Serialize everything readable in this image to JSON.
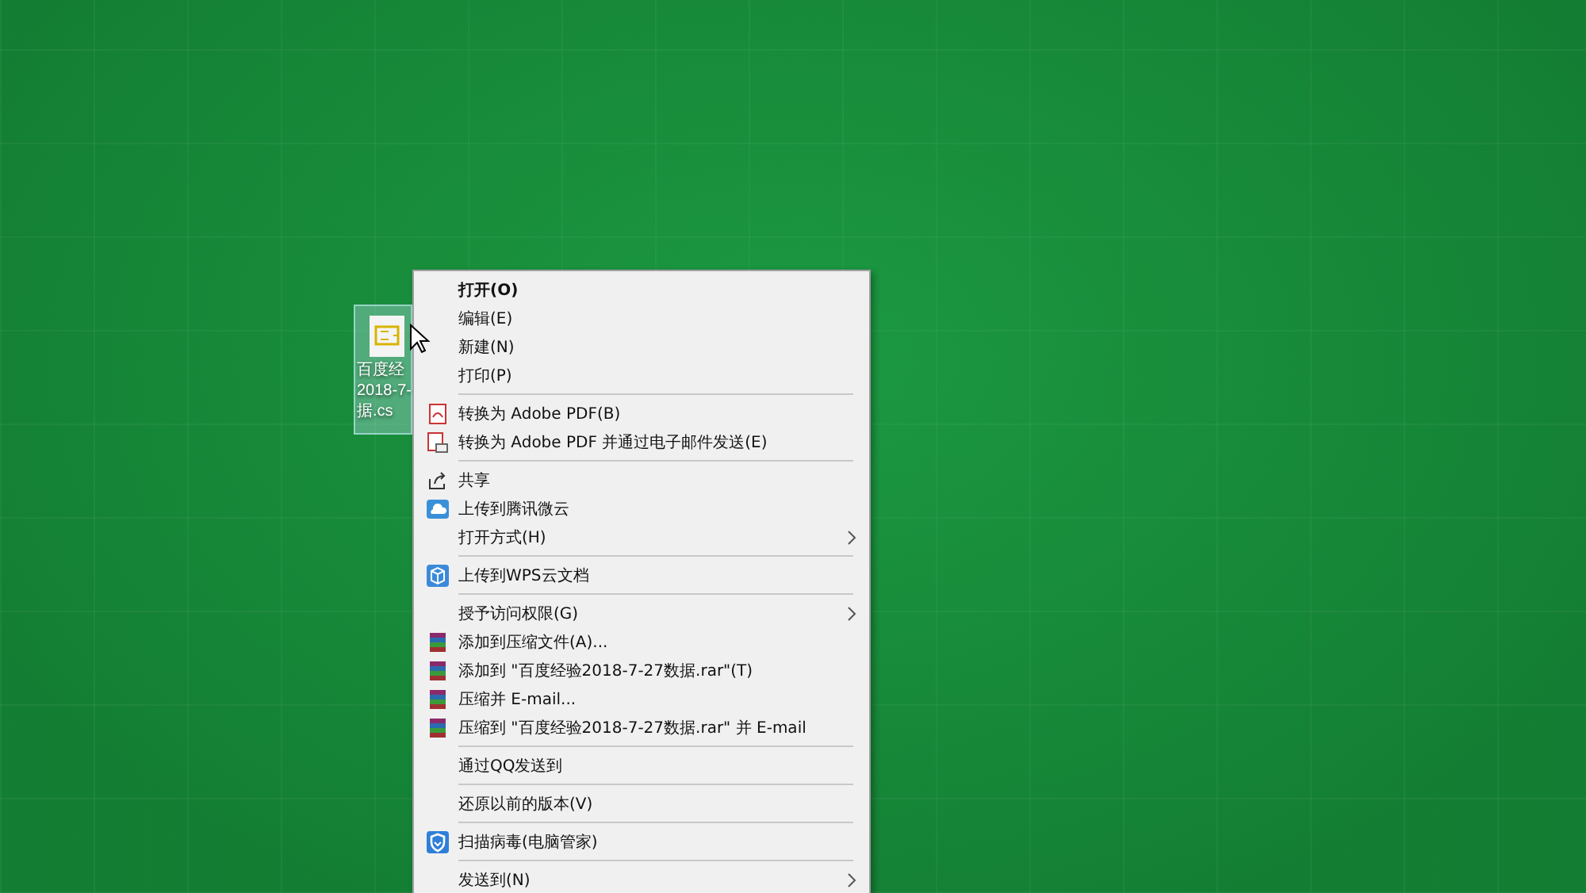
{
  "desktop_icon": {
    "label_lines": [
      "百度经",
      "2018-7-",
      "据.cs"
    ],
    "selected": true
  },
  "context_menu": {
    "sections": [
      {
        "items": [
          {
            "label": "打开(O)",
            "kind": "plain",
            "default": true,
            "submenu": false
          },
          {
            "label": "编辑(E)",
            "kind": "plain",
            "default": false,
            "submenu": false
          },
          {
            "label": "新建(N)",
            "kind": "plain",
            "default": false,
            "submenu": false
          },
          {
            "label": "打印(P)",
            "kind": "plain",
            "default": false,
            "submenu": false
          }
        ]
      },
      {
        "items": [
          {
            "label": "转换为 Adobe PDF(B)",
            "kind": "pdf",
            "default": false,
            "submenu": false
          },
          {
            "label": "转换为 Adobe PDF 并通过电子邮件发送(E)",
            "kind": "pdfmail",
            "default": false,
            "submenu": false
          }
        ]
      },
      {
        "items": [
          {
            "label": "共享",
            "kind": "share",
            "default": false,
            "submenu": false
          },
          {
            "label": "上传到腾讯微云",
            "kind": "cloud",
            "default": false,
            "submenu": false
          },
          {
            "label": "打开方式(H)",
            "kind": "plain",
            "default": false,
            "submenu": true
          }
        ]
      },
      {
        "items": [
          {
            "label": "上传到WPS云文档",
            "kind": "box",
            "default": false,
            "submenu": false
          }
        ]
      },
      {
        "items": [
          {
            "label": "授予访问权限(G)",
            "kind": "plain",
            "default": false,
            "submenu": true
          },
          {
            "label": "添加到压缩文件(A)...",
            "kind": "archive",
            "default": false,
            "submenu": false
          },
          {
            "label": "添加到 \"百度经验2018-7-27数据.rar\"(T)",
            "kind": "archive",
            "default": false,
            "submenu": false
          },
          {
            "label": "压缩并 E-mail...",
            "kind": "archive",
            "default": false,
            "submenu": false
          },
          {
            "label": "压缩到 \"百度经验2018-7-27数据.rar\" 并 E-mail",
            "kind": "archive",
            "default": false,
            "submenu": false
          }
        ]
      },
      {
        "items": [
          {
            "label": "通过QQ发送到",
            "kind": "plain",
            "default": false,
            "submenu": false
          }
        ]
      },
      {
        "items": [
          {
            "label": "还原以前的版本(V)",
            "kind": "plain",
            "default": false,
            "submenu": false
          }
        ]
      },
      {
        "items": [
          {
            "label": "扫描病毒(电脑管家)",
            "kind": "shield",
            "default": false,
            "submenu": false
          }
        ]
      },
      {
        "items": [
          {
            "label": "发送到(N)",
            "kind": "plain",
            "default": false,
            "submenu": true
          }
        ]
      }
    ]
  }
}
